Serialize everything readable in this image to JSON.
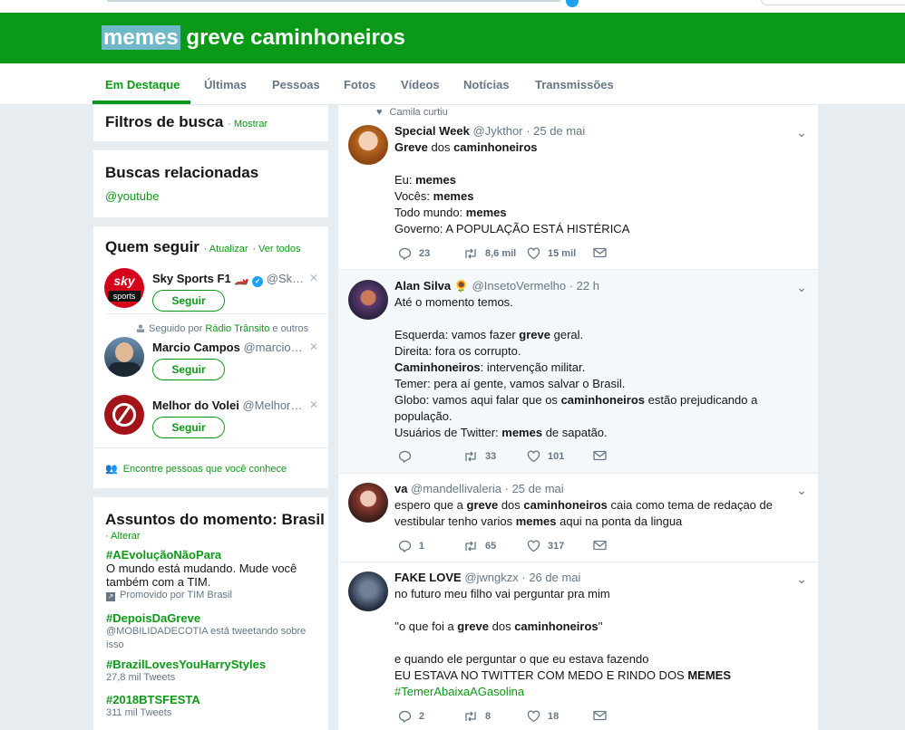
{
  "colors": {
    "accent": "#0b9a17",
    "background": "#e6ecf0",
    "muted": "#657786"
  },
  "search": {
    "query_highlight": "memes",
    "query_rest": " greve caminhoneiros"
  },
  "tabs": [
    {
      "label": "Em Destaque",
      "active": true
    },
    {
      "label": "Últimas"
    },
    {
      "label": "Pessoas"
    },
    {
      "label": "Fotos"
    },
    {
      "label": "Vídeos"
    },
    {
      "label": "Notícias"
    },
    {
      "label": "Transmissões"
    }
  ],
  "filters": {
    "title": "Filtros de busca",
    "action": "· Mostrar"
  },
  "related": {
    "title": "Buscas relacionadas",
    "link": "@youtube"
  },
  "who_to_follow": {
    "title": "Quem seguir",
    "refresh": "· Atualizar",
    "view_all": "· Ver todos",
    "context": "Seguido por",
    "context_name": "Rádio Trânsito",
    "context_rest": "e outros",
    "follow_label": "Seguir",
    "users": [
      {
        "name": "Sky Sports F1 🏎️",
        "handle": "@Sk…",
        "verified": true,
        "avatar_text_1": "sky",
        "avatar_text_2": "sports"
      },
      {
        "name": "Marcio Campos",
        "handle": "@marcio…"
      },
      {
        "name": "Melhor do Volei",
        "handle": "@Melhor…"
      }
    ],
    "find_people": "Encontre pessoas que você conhece"
  },
  "trends": {
    "title": "Assuntos do momento: Brasil",
    "change": "· Alterar",
    "items": [
      {
        "tag": "#AEvoluçãoNãoPara",
        "desc": "O mundo está mudando. Mude você também com a TIM.",
        "meta": "Promovido por TIM Brasil"
      },
      {
        "tag": "#DepoisDaGreve",
        "meta": "@MOBILIDADECOTIA está tweetando sobre isso"
      },
      {
        "tag": "#BrazilLovesYouHarryStyles",
        "meta": "27,8 mil Tweets"
      },
      {
        "tag": "#2018BTSFESTA",
        "meta": "311 mil Tweets"
      }
    ]
  },
  "tweets": [
    {
      "context": "Camila curtiu",
      "name": "Special Week",
      "handle": "@Jykthor",
      "time": "· 25 de mai",
      "body": "<b>Greve</b> dos <b>caminhoneiros</b>\n\nEu: <b>memes</b>\nVocês: <b>memes</b>\nTodo mundo: <b>memes</b>\nGoverno: A POPULAÇÃO ESTÁ HISTÉRICA",
      "replies": "23",
      "retweets": "8,6 mil",
      "likes": "15 mil"
    },
    {
      "name": "Alan Silva 🌻",
      "handle": "@InsetoVermelho",
      "time": "· 22 h",
      "body": "Até o momento temos.\n\nEsquerda: vamos fazer <b>greve</b> geral.\nDireita: fora os corrupto.\n<b>Caminhoneiros</b>: intervenção militar.\nTemer: pera aí gente, vamos salvar o Brasil.\nGlobo: vamos aqui falar que os <b>caminhoneiros</b> estão prejudicando a população.\nUsuários de Twitter: <b>memes</b> de sapatão.",
      "replies": "",
      "retweets": "33",
      "likes": "101"
    },
    {
      "name": "va",
      "handle": "@mandellivaleria",
      "time": "· 25 de mai",
      "body": "espero que a <b>greve</b> dos <b>caminhoneiros</b> caia como tema de redaçao de vestibular tenho varios <b>memes</b> aqui na ponta da lingua",
      "replies": "1",
      "retweets": "65",
      "likes": "317"
    },
    {
      "name": "FAKE LOVE",
      "handle": "@jwngkzx",
      "time": "· 26 de mai",
      "body": "no futuro meu filho vai perguntar pra mim\n\n''o que foi a <b>greve</b> dos <b>caminhoneiros</b>''\n\ne quando ele perguntar o que eu estava fazendo\nEU ESTAVA NO TWITTER COM MEDO E RINDO DOS <b>MEMES</b>\n<span class=\"green\">#TemerAbaixaAGasolina</span>",
      "replies": "2",
      "retweets": "8",
      "likes": "18"
    }
  ]
}
